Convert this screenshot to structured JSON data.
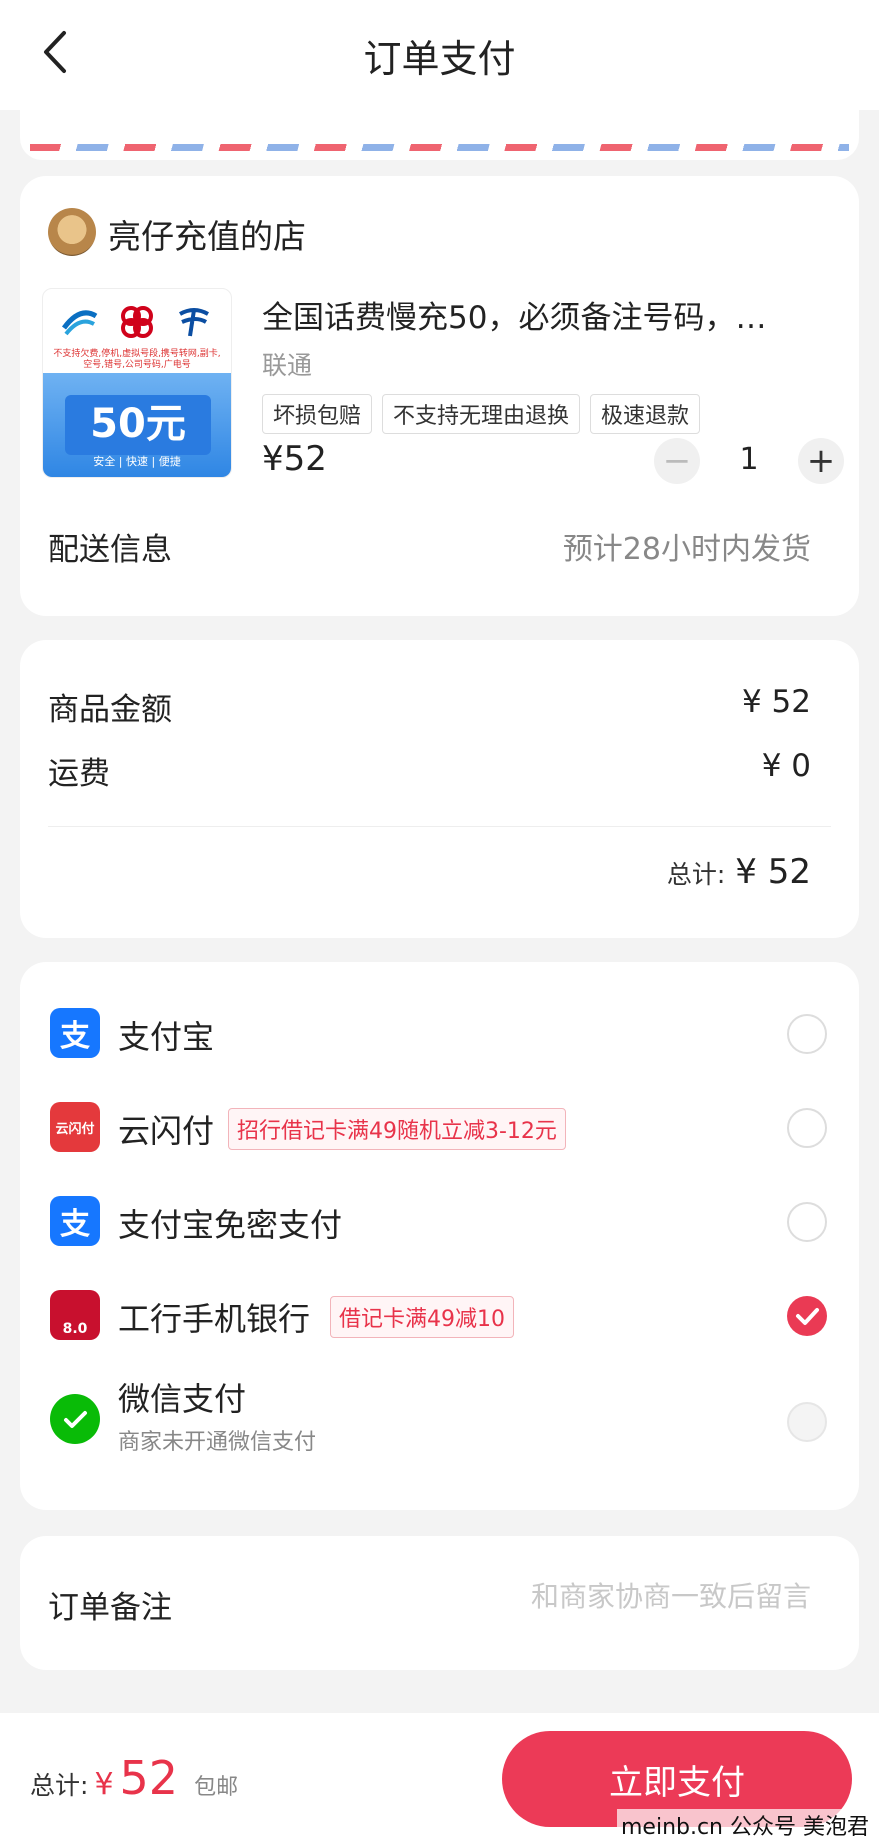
{
  "header": {
    "title": "订单支付",
    "back_icon": "chevron-left-icon"
  },
  "shop": {
    "name": "亮仔充值的店",
    "product": {
      "title": "全国话费慢充50，必须备注号码，…",
      "carrier": "联通",
      "image_face_value": "50元",
      "image_fine_print": "不支持欠费,停机,虚拟号段,携号转网,副卡,空号,错号,公司号码,广电号",
      "image_footer": "安全 | 快速 | 便捷",
      "tags": [
        "坏损包赔",
        "不支持无理由退换",
        "极速退款"
      ],
      "price": "¥52",
      "quantity": "1",
      "minus_symbol": "−",
      "plus_symbol": "+"
    },
    "delivery": {
      "label": "配送信息",
      "value": "预计28小时内发货"
    }
  },
  "summary": {
    "goods_label": "商品金额",
    "goods_value": "¥ 52",
    "shipping_label": "运费",
    "shipping_value": "¥ 0",
    "total_label": "总计:",
    "total_value": "¥ 52"
  },
  "payment_methods": [
    {
      "name": "支付宝",
      "icon": "alipay-icon",
      "icon_text": "支",
      "color": "#1677ff",
      "promo": "",
      "sub": "",
      "state": "unchecked"
    },
    {
      "name": "云闪付",
      "icon": "unionpay-quickpass-icon",
      "icon_text": "云闪付",
      "color": "#e4393c",
      "promo": "招行借记卡满49随机立减3-12元",
      "sub": "",
      "state": "unchecked"
    },
    {
      "name": "支付宝免密支付",
      "icon": "alipay-icon",
      "icon_text": "支",
      "color": "#1677ff",
      "promo": "",
      "sub": "",
      "state": "unchecked"
    },
    {
      "name": "工行手机银行",
      "icon": "icbc-icon",
      "icon_text": "8.0",
      "color": "#c8102e",
      "promo": "借记卡满49减10",
      "sub": "",
      "state": "checked"
    },
    {
      "name": "微信支付",
      "icon": "wechat-pay-icon",
      "icon_text": "",
      "color": "#09bb07",
      "promo": "",
      "sub": "商家未开通微信支付",
      "state": "disabled"
    }
  ],
  "note": {
    "label": "订单备注",
    "placeholder": "和商家协商一致后留言"
  },
  "footer": {
    "total_label": "总计:",
    "currency": "¥",
    "amount": "52",
    "shipping_note": "包邮",
    "pay_button": "立即支付"
  },
  "watermark": "meinb.cn 公众号 美泡君",
  "colors": {
    "accent": "#ec3a57",
    "price_red": "#e8334a",
    "background": "#f3f3f3"
  }
}
